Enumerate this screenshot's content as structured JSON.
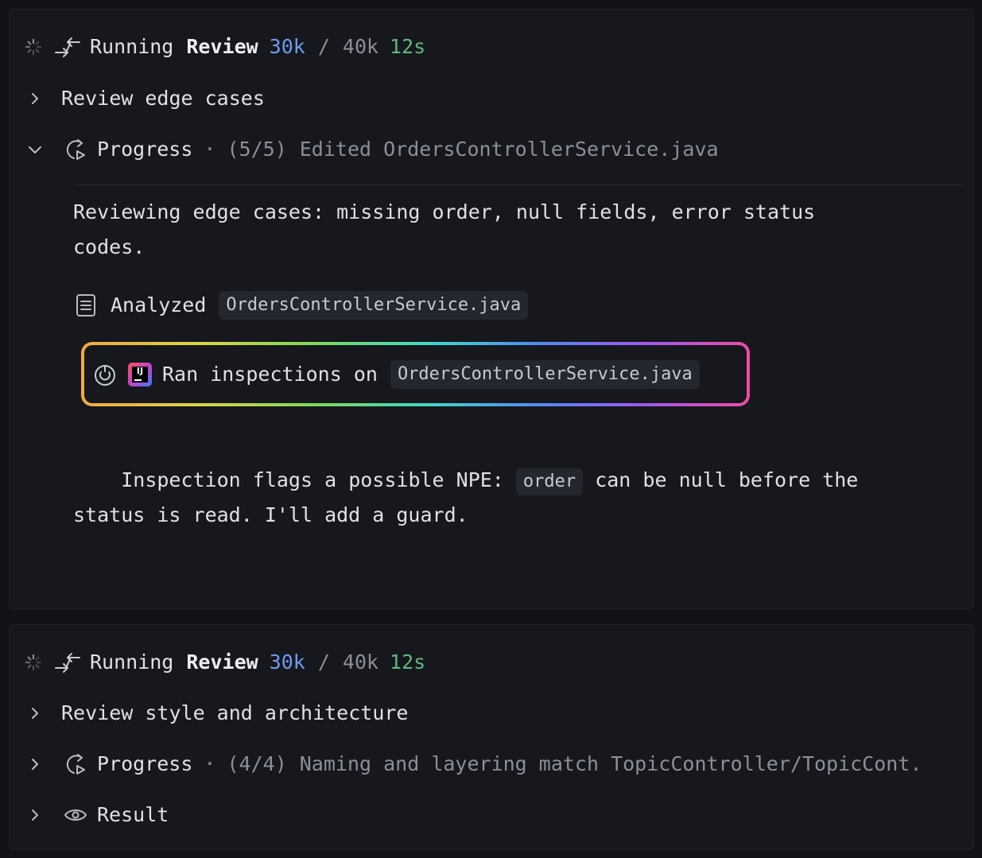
{
  "panels": [
    {
      "header": {
        "status": "Running",
        "name": "Review",
        "tokens_used": "30k",
        "separator": "/",
        "tokens_total": "40k",
        "time": "12s"
      },
      "task": {
        "label": "Review edge cases"
      },
      "progress": {
        "label": "Progress",
        "dot": "·",
        "count": "(5/5)",
        "summary": "Edited OrdersControllerService.java"
      },
      "message1": "Reviewing edge cases: missing order, null fields, error status\ncodes.",
      "analyzed": {
        "label": "Analyzed",
        "file": "OrdersControllerService.java"
      },
      "inspection": {
        "label": "Ran inspections on",
        "file": "OrdersControllerService.java",
        "badge": "IJ"
      },
      "message2": {
        "before": "Inspection flags a possible NPE: ",
        "code": "order",
        "after": " can be null before the",
        "line2": "status is read. I'll add a guard."
      }
    },
    {
      "header": {
        "status": "Running",
        "name": "Review",
        "tokens_used": "30k",
        "separator": "/",
        "tokens_total": "40k",
        "time": "12s"
      },
      "task": {
        "label": "Review style and architecture"
      },
      "progress": {
        "label": "Progress",
        "dot": "·",
        "count": "(4/4)",
        "summary": "Naming and layering match TopicController/TopicCont."
      },
      "result": {
        "label": "Result"
      }
    }
  ],
  "colors": {
    "accent_blue": "#6f9cf0",
    "accent_green": "#5fb67a",
    "background": "#111318",
    "panel": "#16181d"
  },
  "icons": [
    "spinner-icon",
    "handoff-arrows-icon",
    "chevron-right-icon",
    "chevron-down-icon",
    "progress-refresh-icon",
    "document-icon",
    "inspection-power-icon",
    "intellij-logo-icon",
    "eye-icon"
  ]
}
